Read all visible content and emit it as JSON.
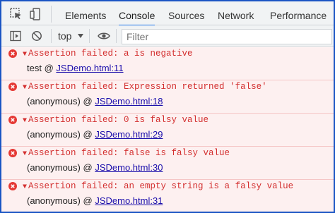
{
  "tabs": [
    "Elements",
    "Console",
    "Sources",
    "Network",
    "Performance"
  ],
  "active_tab": "Console",
  "toolbar": {
    "context": "top",
    "filter_placeholder": "Filter"
  },
  "messages": [
    {
      "text": "Assertion failed: a is negative",
      "caller": "test",
      "at": "@",
      "source": "JSDemo.html:11"
    },
    {
      "text": "Assertion failed: Expression returned 'false'",
      "caller": "(anonymous)",
      "at": "@",
      "source": "JSDemo.html:18"
    },
    {
      "text": "Assertion failed: 0 is falsy value",
      "caller": "(anonymous)",
      "at": "@",
      "source": "JSDemo.html:29"
    },
    {
      "text": "Assertion failed: false is falsy value",
      "caller": "(anonymous)",
      "at": "@",
      "source": "JSDemo.html:30"
    },
    {
      "text": "Assertion failed: an empty string is a falsy value",
      "caller": "(anonymous)",
      "at": "@",
      "source": "JSDemo.html:31"
    }
  ],
  "colors": {
    "error_text": "#d32f2f",
    "error_bg": "#fdf0f0",
    "link": "#1a0dab",
    "active_underline": "#1a73e8",
    "frame_border": "#1a55c4"
  }
}
